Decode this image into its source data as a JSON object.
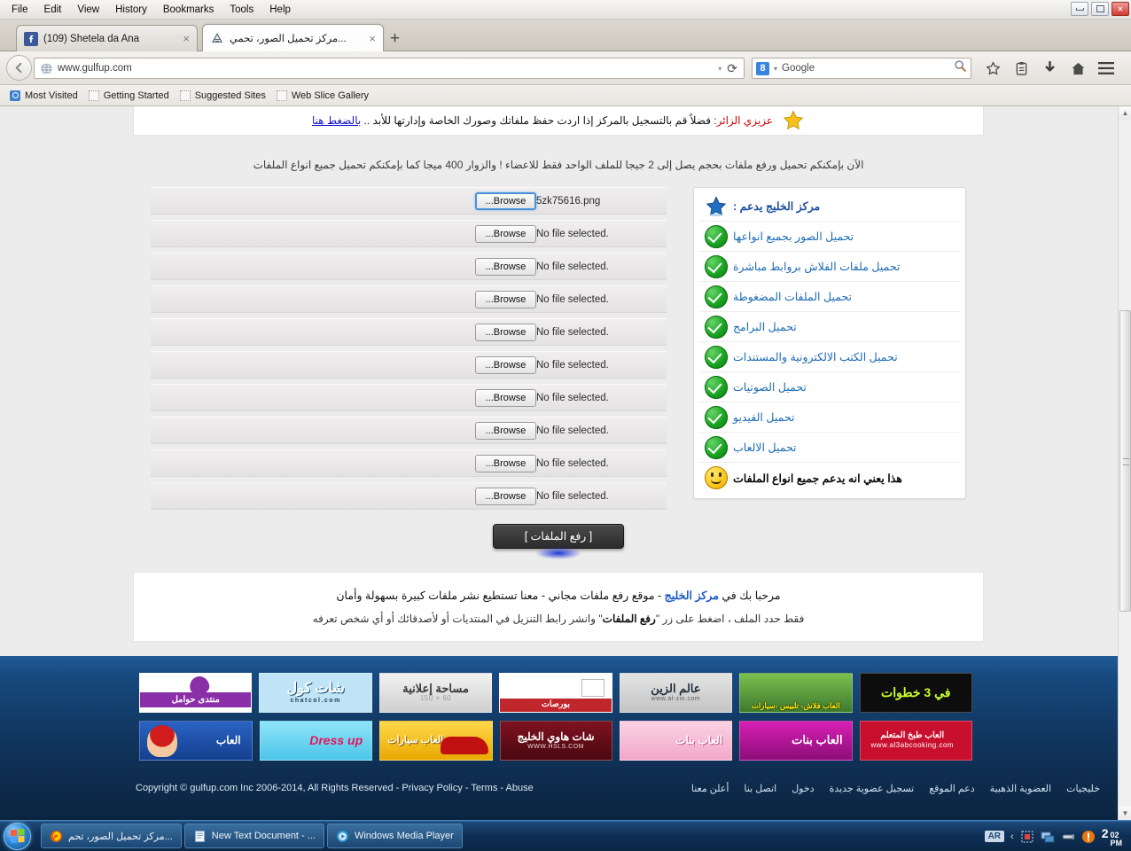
{
  "browser": {
    "menus": [
      "File",
      "Edit",
      "View",
      "History",
      "Bookmarks",
      "Tools",
      "Help"
    ],
    "window_controls": {
      "minimize": "minimize-icon",
      "restore": "restore-icon",
      "close": "×"
    },
    "tabs": [
      {
        "label": "(109) Shetela da Ana",
        "favicon": "facebook-icon",
        "close": "×",
        "active": false
      },
      {
        "label": "مركز تحميل الصور، تحمي...",
        "favicon": "gulfup-icon",
        "close": "×",
        "active": true
      }
    ],
    "new_tab": "+",
    "url": "www.gulfup.com",
    "url_dropdown": "▾",
    "reload": "⟳",
    "back": "←",
    "search_engine": "Google",
    "search_engine_badge": "8",
    "search_dropdown": "▾",
    "nav_icons": [
      "bookmark-star-icon",
      "reading-list-icon",
      "downloads-icon",
      "home-icon",
      "menu-icon"
    ],
    "bookmarks": [
      "Most Visited",
      "Getting Started",
      "Suggested Sites",
      "Web Slice Gallery"
    ],
    "scrollbar": {
      "up": "▲",
      "down": "▼"
    }
  },
  "page": {
    "notice": {
      "red": "عزيزي الزائر",
      "body": ": فضلاً قم بالتسجيل بالمركز إذا اردت حفظ ملفاتك وصورك الخاصة وإدارتها للأبد ..",
      "link": "بالضغط هنا"
    },
    "info_line": "الآن بإمكنكم تحميل ورفع ملفات بحجم يصل إلى 2 جيجا للملف الواحد فقط للاعضاء ! والزوار 400 ميجا كما بإمكنكم تحميل جميع انواع الملفات",
    "upload_rows": [
      {
        "filename": "5zk75616.png",
        "browse": "Browse...",
        "focused": true
      },
      {
        "filename": "No file selected.",
        "browse": "Browse...",
        "focused": false
      },
      {
        "filename": "No file selected.",
        "browse": "Browse...",
        "focused": false
      },
      {
        "filename": "No file selected.",
        "browse": "Browse...",
        "focused": false
      },
      {
        "filename": "No file selected.",
        "browse": "Browse...",
        "focused": false
      },
      {
        "filename": "No file selected.",
        "browse": "Browse...",
        "focused": false
      },
      {
        "filename": "No file selected.",
        "browse": "Browse...",
        "focused": false
      },
      {
        "filename": "No file selected.",
        "browse": "Browse...",
        "focused": false
      },
      {
        "filename": "No file selected.",
        "browse": "Browse...",
        "focused": false
      },
      {
        "filename": "No file selected.",
        "browse": "Browse...",
        "focused": false
      }
    ],
    "support_panel": {
      "title": "مركز الخليج يدعم :",
      "title_icon": "blue-star-icon",
      "items": [
        {
          "label": "تحميل الصور بجميع انواعها",
          "icon": "green-check-icon"
        },
        {
          "label": "تحميل ملفات الفلاش بروابط مباشرة",
          "icon": "green-check-icon"
        },
        {
          "label": "تحميل الملفات المضغوطة",
          "icon": "green-check-icon"
        },
        {
          "label": "تحميل البرامج",
          "icon": "green-check-icon"
        },
        {
          "label": "تحميل الكتب الالكترونية والمستندات",
          "icon": "green-check-icon"
        },
        {
          "label": "تحميل الصوتيات",
          "icon": "green-check-icon"
        },
        {
          "label": "تحميل الفيديو",
          "icon": "green-check-icon"
        },
        {
          "label": "تحميل الالعاب",
          "icon": "green-check-icon"
        }
      ],
      "footer": {
        "label": "هذا يعني انه يدعم جميع انواع الملفات",
        "icon": "smiley-icon"
      }
    },
    "submit_button": "[ رفع الملفات ]",
    "welcome": {
      "line1_a": "مرحبا بك في ",
      "line1_hl": "مركز الخليج",
      "line1_b": " - موقع رفع ملفات مجاني - معنا تستطيع نشر ملفات كبيرة بسهولة وأمان",
      "line2_a": "فقط حدد الملف ، اضغط على زر \"",
      "line2_hl": "رفع الملفات",
      "line2_b": "\" وانشر رابط التنزيل في المنتديات أو لأصدقائك أو أي شخص تعرفه"
    },
    "ads": [
      [
        {
          "text": "منتدى حوامل",
          "sub": "",
          "bg": "#ffffff",
          "fg": "#ffffff",
          "accent": "#8b2fa8"
        },
        {
          "text": "شات كول",
          "sub": "chatcol.com",
          "bg": "#bfe4f5",
          "fg": "#ffffff",
          "accent": "#1d5f8f"
        },
        {
          "text": "مساحة إعلانية",
          "sub": "60 × 150",
          "bg": "#dcdcdc",
          "fg": "#3a3a3a",
          "accent": "#9a9a9a"
        },
        {
          "text": "بورصات",
          "sub": "",
          "bg": "#ffffff",
          "fg": "#ffffff",
          "accent": "#c0272d"
        },
        {
          "text": "عالم الزين",
          "sub": "www.al-zin.com",
          "bg": "#d8d8d8",
          "fg": "#2b2b2b",
          "accent": "#555555"
        },
        {
          "text": "العاب فلاش- تلبيس -سيارات",
          "sub": "",
          "bg": "#4c8c3f",
          "fg": "#ffe800",
          "accent": "#2e5c24"
        },
        {
          "text": "في 3 خطوات",
          "sub": "",
          "bg": "#0d0d0d",
          "fg": "#c8ff2a",
          "accent": "#3aff00"
        }
      ],
      [
        {
          "text": "العاب",
          "sub": "",
          "bg": "#1b4da8",
          "fg": "#ffffff",
          "accent": "#d01c1c"
        },
        {
          "text": "Dress up",
          "sub": "",
          "bg": "#5fd0f0",
          "fg": "#e8125c",
          "accent": "#ffffff"
        },
        {
          "text": "العاب سيارات",
          "sub": "",
          "bg": "#f2c000",
          "fg": "#ffffff",
          "accent": "#c01010"
        },
        {
          "text": "شات هاوي الخليج",
          "sub": "WWW.HSLS.COM",
          "bg": "#6b0f18",
          "fg": "#ffffff",
          "accent": "#ffffff"
        },
        {
          "text": "العاب بنات",
          "sub": "",
          "bg": "#f7b8d2",
          "fg": "#ffffff",
          "accent": "#e0609a"
        },
        {
          "text": "العاب بنات",
          "sub": "",
          "bg": "#c4189c",
          "fg": "#ffffff",
          "accent": "#ffd24a"
        },
        {
          "text": "العاب طبخ المتعلم",
          "sub": "www.al3abcooking.com",
          "bg": "#c8102e",
          "fg": "#ffffff",
          "accent": "#ffffff"
        }
      ]
    ],
    "copyright": "Copyright © gulfup.com Inc 2006-2014, All Rights Reserved - Privacy Policy - Terms - Abuse",
    "footer_links": [
      "خليجيات",
      "العضوية الذهبية",
      "دعم الموقع",
      "تسجيل عضوية جديدة",
      "دخول",
      "اتصل بنا",
      "أعلن معنا"
    ]
  },
  "taskbar": {
    "start": "start-orb-icon",
    "tasks": [
      {
        "label": "مركز تحميل الصور، تحم...",
        "icon": "firefox-icon"
      },
      {
        "label": "New Text Document - ...",
        "icon": "notepad-icon"
      },
      {
        "label": "Windows Media Player",
        "icon": "wmp-icon"
      }
    ],
    "tray": {
      "language": "AR",
      "chevron": "‹",
      "icons": [
        "network-icon",
        "volume-icon",
        "action-center-icon"
      ]
    },
    "clock": {
      "hour": "2",
      "minutes": "02",
      "meridiem": "PM"
    }
  }
}
